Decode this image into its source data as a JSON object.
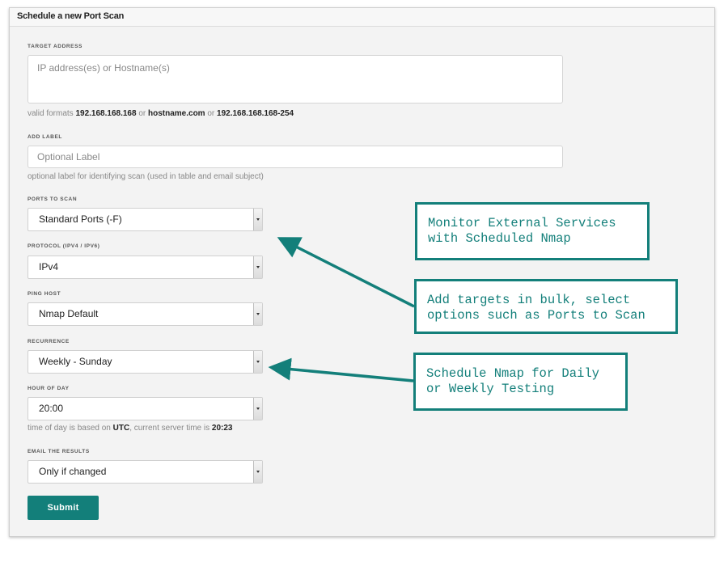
{
  "panel": {
    "title": "Schedule a new Port Scan"
  },
  "target": {
    "label": "TARGET ADDRESS",
    "placeholder": "IP address(es) or Hostname(s)",
    "help_prefix": "valid formats ",
    "example_ip": "192.168.168.168",
    "or1": " or ",
    "example_host": "hostname.com",
    "or2": " or ",
    "example_range": "192.168.168.168-254"
  },
  "label_field": {
    "label": "ADD LABEL",
    "placeholder": "Optional Label",
    "help": "optional label for identifying scan (used in table and email subject)"
  },
  "ports": {
    "label": "PORTS TO SCAN",
    "value": "Standard Ports (-F)"
  },
  "protocol": {
    "label": "PROTOCOL (IPV4 / IPV6)",
    "value": "IPv4"
  },
  "ping": {
    "label": "PING HOST",
    "value": "Nmap Default"
  },
  "recurrence": {
    "label": "RECURRENCE",
    "value": "Weekly - Sunday"
  },
  "hour": {
    "label": "HOUR OF DAY",
    "value": "20:00",
    "help_prefix": "time of day is based on ",
    "tz": "UTC",
    "help_mid": ", current server time is ",
    "server_time": "20:23"
  },
  "email": {
    "label": "EMAIL THE RESULTS",
    "value": "Only if changed"
  },
  "submit_label": "Submit",
  "callouts": {
    "monitor": "Monitor External Services\nwith Scheduled Nmap",
    "bulk": "Add targets in bulk, select\noptions such as Ports to Scan",
    "schedule": "Schedule Nmap for Daily\nor Weekly Testing"
  },
  "colors": {
    "accent": "#137f7a",
    "panel_bg": "#f3f3f3"
  }
}
